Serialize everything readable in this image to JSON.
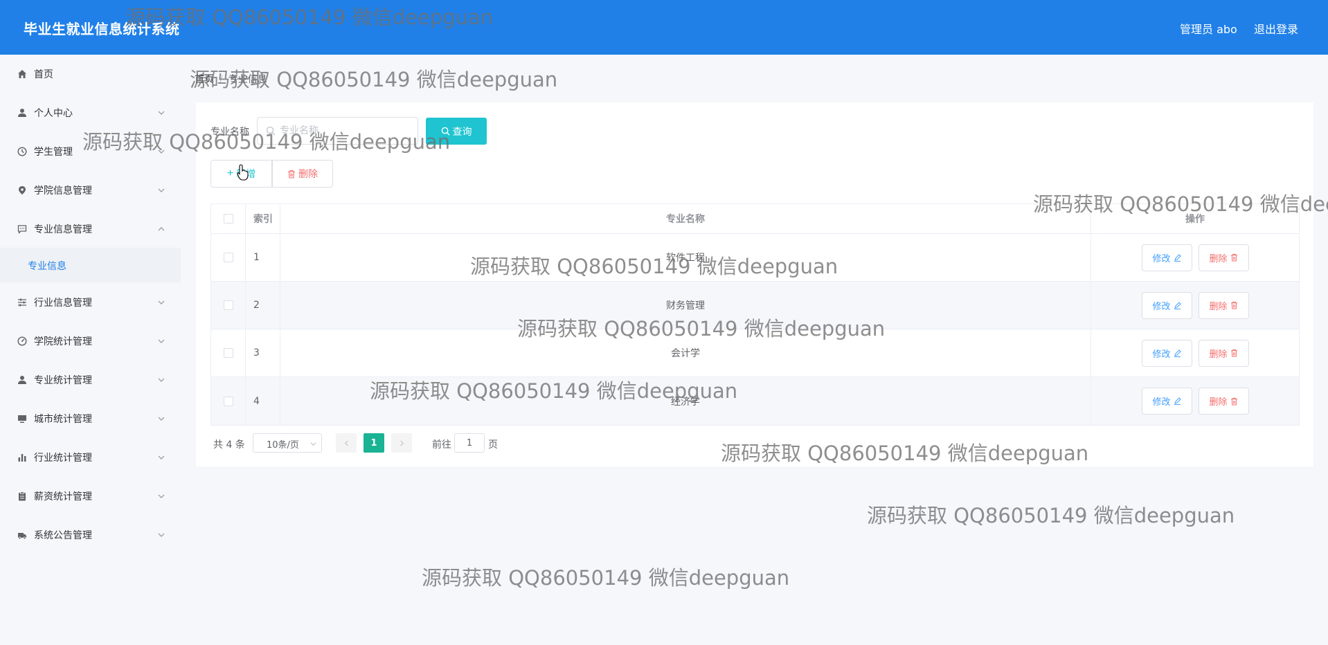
{
  "header": {
    "title": "毕业生就业信息统计系统",
    "admin_label": "管理员 abo",
    "logout_label": "退出登录",
    "background_color": "#2080e8"
  },
  "sidebar": {
    "items": [
      {
        "label": "首页",
        "icon": "home-icon",
        "expandable": false
      },
      {
        "label": "个人中心",
        "icon": "user-icon",
        "expandable": true
      },
      {
        "label": "学生管理",
        "icon": "clock-icon",
        "expandable": true
      },
      {
        "label": "学院信息管理",
        "icon": "location-icon",
        "expandable": true
      },
      {
        "label": "专业信息管理",
        "icon": "chat-icon",
        "expandable": true,
        "expanded": true,
        "children": [
          {
            "label": "专业信息",
            "active": true
          }
        ]
      },
      {
        "label": "行业信息管理",
        "icon": "sliders-icon",
        "expandable": true
      },
      {
        "label": "学院统计管理",
        "icon": "gauge-icon",
        "expandable": true
      },
      {
        "label": "专业统计管理",
        "icon": "user-icon",
        "expandable": true
      },
      {
        "label": "城市统计管理",
        "icon": "monitor-icon",
        "expandable": true
      },
      {
        "label": "行业统计管理",
        "icon": "bar-chart-icon",
        "expandable": true
      },
      {
        "label": "薪资统计管理",
        "icon": "clipboard-icon",
        "expandable": true
      },
      {
        "label": "系统公告管理",
        "icon": "truck-icon",
        "expandable": true
      }
    ]
  },
  "breadcrumb": {
    "home": "首页",
    "current": "专业信息"
  },
  "search": {
    "label": "专业名称",
    "placeholder": "专业名称",
    "value": "",
    "query_button": "查询"
  },
  "actions": {
    "add_label": "新增",
    "delete_label": "删除"
  },
  "table": {
    "columns": [
      "",
      "索引",
      "专业名称",
      "操作"
    ],
    "rows": [
      {
        "index": "1",
        "name": "软件工程"
      },
      {
        "index": "2",
        "name": "财务管理"
      },
      {
        "index": "3",
        "name": "会计学"
      },
      {
        "index": "4",
        "name": "经济学"
      }
    ],
    "edit_label": "修改",
    "delete_label": "删除"
  },
  "pagination": {
    "total_text": "共 4 条",
    "page_size": "10条/页",
    "current_page": "1",
    "goto_prefix": "前往",
    "goto_value": "1",
    "goto_suffix": "页"
  },
  "watermark": "源码获取 QQ86050149 微信deepguan",
  "colors": {
    "accent": "#1fc4d0",
    "danger": "#f56c6c",
    "edit": "#409eff",
    "active_page": "#1ab394"
  }
}
